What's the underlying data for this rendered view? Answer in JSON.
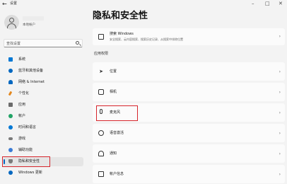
{
  "window": {
    "title": "设置",
    "back": "←",
    "minimize": "–",
    "maximize": "□",
    "close": "✕"
  },
  "account": {
    "type": "本地帐户"
  },
  "search": {
    "placeholder": "查找设置"
  },
  "sidebar": {
    "items": [
      {
        "label": "系统",
        "icon": "monitor-icon",
        "color": "#0078d4"
      },
      {
        "label": "蓝牙和其他设备",
        "icon": "bluetooth-icon",
        "color": "#0067c0"
      },
      {
        "label": "网络 & Internet",
        "icon": "wifi-icon",
        "color": "#0067c0"
      },
      {
        "label": "个性化",
        "icon": "brush-icon",
        "color": "#e3881f"
      },
      {
        "label": "应用",
        "icon": "apps-icon",
        "color": "#6b6b6b"
      },
      {
        "label": "帐户",
        "icon": "person-icon",
        "color": "#21a366"
      },
      {
        "label": "时间和语言",
        "icon": "globe-clock-icon",
        "color": "#0078d4"
      },
      {
        "label": "游戏",
        "icon": "gamepad-icon",
        "color": "#7a7a7a"
      },
      {
        "label": "辅助功能",
        "icon": "accessibility-icon",
        "color": "#3a7bd5"
      },
      {
        "label": "隐私和安全性",
        "icon": "shield-icon",
        "color": "#7a7a7a",
        "selected": true
      },
      {
        "label": "Windows 更新",
        "icon": "update-icon",
        "color": "#0067c0"
      }
    ]
  },
  "main": {
    "title": "隐私和安全性",
    "top_card": {
      "label": "搜索 Windows",
      "description": "安全搜索、云内容搜索、搜索历史记录、从搜索中排除位置"
    },
    "section_label": "应用权限",
    "permissions": [
      {
        "label": "位置",
        "icon": "location-icon"
      },
      {
        "label": "相机",
        "icon": "camera-icon"
      },
      {
        "label": "麦克风",
        "icon": "microphone-icon"
      },
      {
        "label": "语音激活",
        "icon": "voice-icon"
      },
      {
        "label": "通知",
        "icon": "bell-icon"
      },
      {
        "label": "帐户信息",
        "icon": "account-info-icon"
      }
    ],
    "chevron": "›"
  },
  "colors": {
    "accent": "#0067c0",
    "highlight": "#d6252c"
  }
}
